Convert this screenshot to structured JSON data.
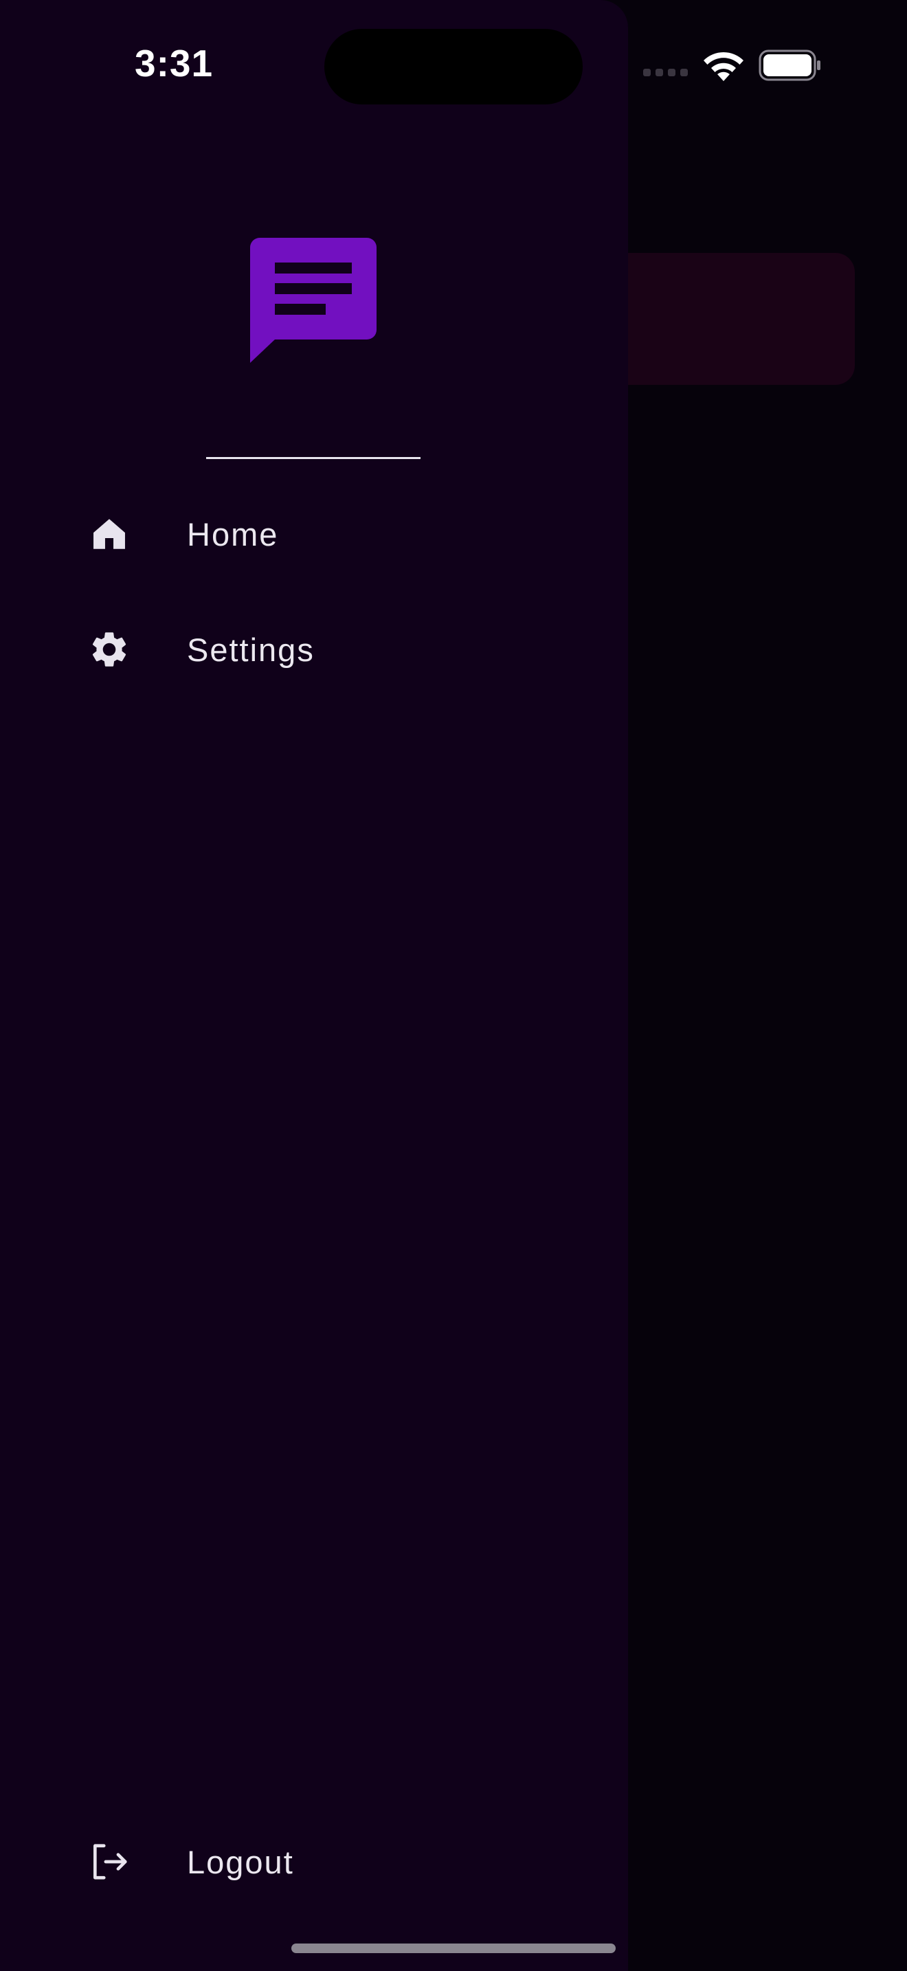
{
  "status_bar": {
    "time": "3:31"
  },
  "drawer": {
    "logo_icon": "chat-message-icon",
    "logo_color": "#7210c0",
    "items": [
      {
        "label": "Home",
        "icon": "home-icon"
      },
      {
        "label": "Settings",
        "icon": "gear-icon"
      }
    ],
    "footer": {
      "label": "Logout",
      "icon": "logout-icon"
    }
  },
  "colors": {
    "drawer_background": "#10011a",
    "page_background": "#06020b",
    "card_background": "#1a0316"
  }
}
